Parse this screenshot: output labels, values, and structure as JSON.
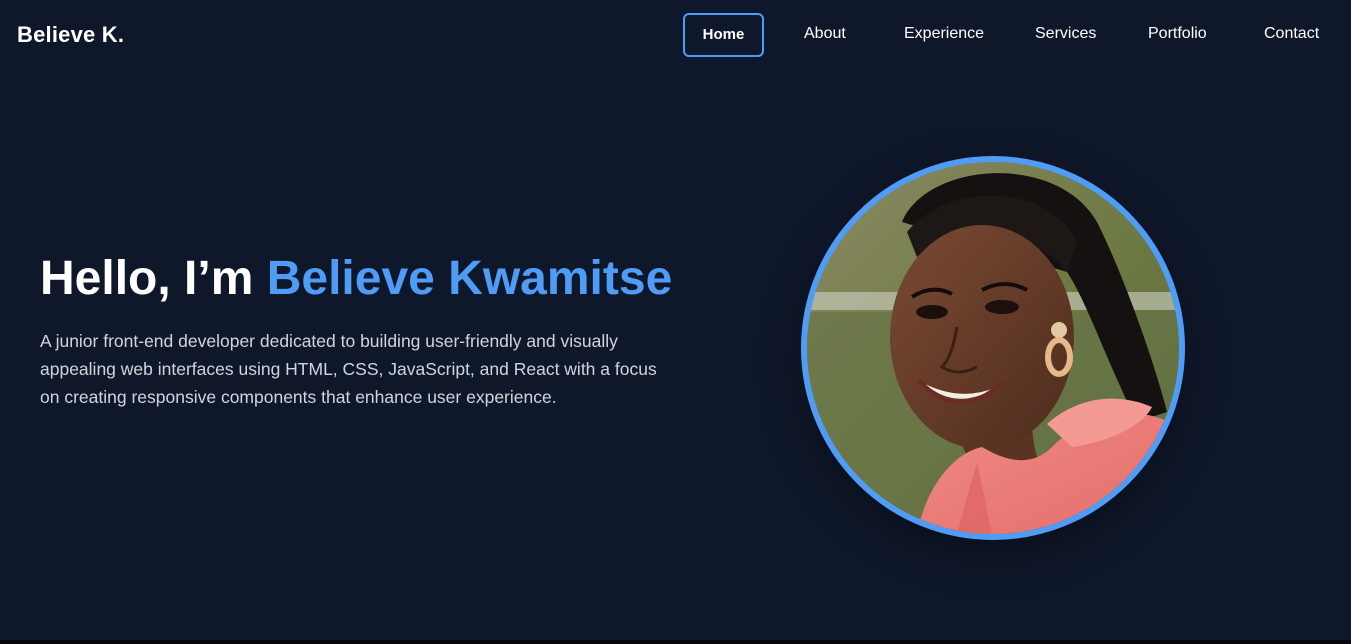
{
  "header": {
    "logo": "Believe K.",
    "nav": [
      {
        "label": "Home",
        "active": true
      },
      {
        "label": "About",
        "active": false
      },
      {
        "label": "Experience",
        "active": false
      },
      {
        "label": "Services",
        "active": false
      },
      {
        "label": "Portfolio",
        "active": false
      },
      {
        "label": "Contact",
        "active": false
      }
    ]
  },
  "hero": {
    "greeting": "Hello, I’m ",
    "name": "Believe Kwamitse",
    "description": "A junior front-end developer dedicated to building user-friendly and visually appealing web interfaces using HTML, CSS, JavaScript, and React with a focus on creating responsive components that enhance user experience."
  },
  "colors": {
    "background": "#0f172a",
    "accent": "#4f9cf7",
    "text": "#ffffff",
    "muted_text": "#d1d5db"
  }
}
